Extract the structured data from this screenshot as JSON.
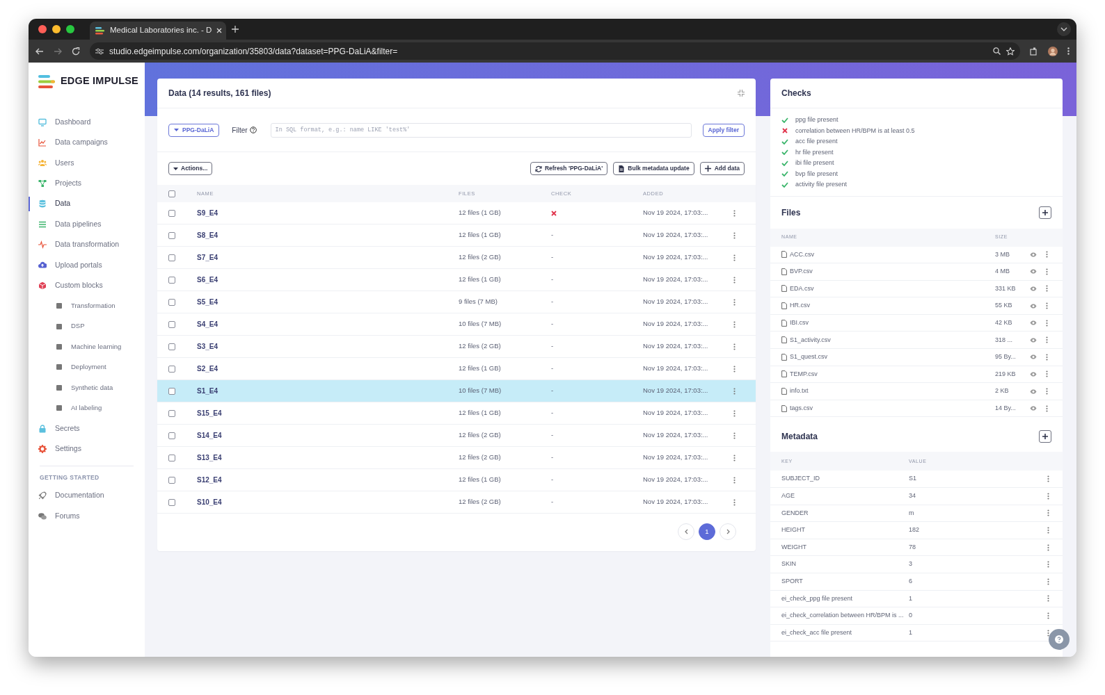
{
  "browser": {
    "tab_title": "Medical Laboratories inc. - D",
    "url": "studio.edgeimpulse.com/organization/35803/data?dataset=PPG-DaLiA&filter="
  },
  "sidebar": {
    "logo": "EDGE IMPULSE",
    "items": [
      {
        "label": "Dashboard",
        "selected": false
      },
      {
        "label": "Data campaigns",
        "selected": false
      },
      {
        "label": "Users",
        "selected": false
      },
      {
        "label": "Projects",
        "selected": false
      },
      {
        "label": "Data",
        "selected": true
      },
      {
        "label": "Data pipelines",
        "selected": false
      },
      {
        "label": "Data transformation",
        "selected": false
      },
      {
        "label": "Upload portals",
        "selected": false
      },
      {
        "label": "Custom blocks",
        "selected": false,
        "children": [
          {
            "label": "Transformation",
            "selected": false
          },
          {
            "label": "DSP",
            "selected": false
          },
          {
            "label": "Machine learning",
            "selected": false
          },
          {
            "label": "Deployment",
            "selected": false
          },
          {
            "label": "Synthetic data",
            "selected": false
          },
          {
            "label": "AI labeling",
            "selected": false
          }
        ]
      },
      {
        "label": "Secrets",
        "selected": false
      },
      {
        "label": "Settings",
        "selected": false
      }
    ],
    "section_heading": "GETTING STARTED",
    "section_items": [
      {
        "label": "Documentation"
      },
      {
        "label": "Forums"
      }
    ]
  },
  "data_card": {
    "title": "Data (14 results, 161 files)",
    "dataset": "PPG-DaLiA",
    "filter_label": "Filter",
    "filter_placeholder": "In SQL format, e.g.: name LIKE 'test%'",
    "apply_button": "Apply filter",
    "actions_button": "Actions...",
    "select_all_checked": false,
    "toolbar": [
      "Refresh 'PPG-DaLiA'",
      "Bulk metadata update",
      "Add data"
    ],
    "columns": [
      "NAME",
      "FILES",
      "CHECK",
      "ADDED"
    ],
    "rows": [
      {
        "name": "S9_E4",
        "files": "12 files (1 GB)",
        "check": {
          "kind": "fail"
        },
        "added": "Nov 19 2024, 17:03:...",
        "checked": false,
        "selected": false
      },
      {
        "name": "S8_E4",
        "files": "12 files (1 GB)",
        "check": {
          "kind": "text",
          "text": "-"
        },
        "added": "Nov 19 2024, 17:03:...",
        "checked": false,
        "selected": false
      },
      {
        "name": "S7_E4",
        "files": "12 files (2 GB)",
        "check": {
          "kind": "text",
          "text": "-"
        },
        "added": "Nov 19 2024, 17:03:...",
        "checked": false,
        "selected": false
      },
      {
        "name": "S6_E4",
        "files": "12 files (1 GB)",
        "check": {
          "kind": "text",
          "text": "-"
        },
        "added": "Nov 19 2024, 17:03:...",
        "checked": false,
        "selected": false
      },
      {
        "name": "S5_E4",
        "files": "9 files (7 MB)",
        "check": {
          "kind": "text",
          "text": "-"
        },
        "added": "Nov 19 2024, 17:03:...",
        "checked": false,
        "selected": false
      },
      {
        "name": "S4_E4",
        "files": "10 files (7 MB)",
        "check": {
          "kind": "text",
          "text": "-"
        },
        "added": "Nov 19 2024, 17:03:...",
        "checked": false,
        "selected": false
      },
      {
        "name": "S3_E4",
        "files": "12 files (2 GB)",
        "check": {
          "kind": "text",
          "text": "-"
        },
        "added": "Nov 19 2024, 17:03:...",
        "checked": false,
        "selected": false
      },
      {
        "name": "S2_E4",
        "files": "12 files (1 GB)",
        "check": {
          "kind": "text",
          "text": "-"
        },
        "added": "Nov 19 2024, 17:03:...",
        "checked": false,
        "selected": false
      },
      {
        "name": "S1_E4",
        "files": "10 files (7 MB)",
        "check": {
          "kind": "text",
          "text": "-"
        },
        "added": "Nov 19 2024, 17:03:...",
        "checked": false,
        "selected": true
      },
      {
        "name": "S15_E4",
        "files": "12 files (1 GB)",
        "check": {
          "kind": "text",
          "text": "-"
        },
        "added": "Nov 19 2024, 17:03:...",
        "checked": false,
        "selected": false
      },
      {
        "name": "S14_E4",
        "files": "12 files (2 GB)",
        "check": {
          "kind": "text",
          "text": "-"
        },
        "added": "Nov 19 2024, 17:03:...",
        "checked": false,
        "selected": false
      },
      {
        "name": "S13_E4",
        "files": "12 files (2 GB)",
        "check": {
          "kind": "text",
          "text": "-"
        },
        "added": "Nov 19 2024, 17:03:...",
        "checked": false,
        "selected": false
      },
      {
        "name": "S12_E4",
        "files": "12 files (1 GB)",
        "check": {
          "kind": "text",
          "text": "-"
        },
        "added": "Nov 19 2024, 17:03:...",
        "checked": false,
        "selected": false
      },
      {
        "name": "S10_E4",
        "files": "12 files (2 GB)",
        "check": {
          "kind": "text",
          "text": "-"
        },
        "added": "Nov 19 2024, 17:03:...",
        "checked": false,
        "selected": false
      }
    ],
    "pages": [
      {
        "label": "1",
        "selected": true
      }
    ]
  },
  "checks": {
    "title": "Checks",
    "items": [
      {
        "text": "ppg file present",
        "passed": true
      },
      {
        "text": "correlation between HR/BPM is at least 0.5",
        "passed": false
      },
      {
        "text": "acc file present",
        "passed": true
      },
      {
        "text": "hr file present",
        "passed": true
      },
      {
        "text": "ibi file present",
        "passed": true
      },
      {
        "text": "bvp file present",
        "passed": true
      },
      {
        "text": "activity file present",
        "passed": true
      }
    ]
  },
  "files": {
    "title": "Files",
    "columns": [
      "NAME",
      "SIZE"
    ],
    "rows": [
      {
        "name": "ACC.csv",
        "size": "3 MB"
      },
      {
        "name": "BVP.csv",
        "size": "4 MB"
      },
      {
        "name": "EDA.csv",
        "size": "331 KB"
      },
      {
        "name": "HR.csv",
        "size": "55 KB"
      },
      {
        "name": "IBI.csv",
        "size": "42 KB"
      },
      {
        "name": "S1_activity.csv",
        "size": "318 ..."
      },
      {
        "name": "S1_quest.csv",
        "size": "95 By..."
      },
      {
        "name": "TEMP.csv",
        "size": "219 KB"
      },
      {
        "name": "info.txt",
        "size": "2 KB"
      },
      {
        "name": "tags.csv",
        "size": "14 By..."
      }
    ]
  },
  "metadata": {
    "title": "Metadata",
    "columns": [
      "KEY",
      "VALUE"
    ],
    "rows": [
      {
        "key": "SUBJECT_ID",
        "value": "S1"
      },
      {
        "key": "AGE",
        "value": "34"
      },
      {
        "key": "GENDER",
        "value": "m"
      },
      {
        "key": "HEIGHT",
        "value": "182"
      },
      {
        "key": "WEIGHT",
        "value": "78"
      },
      {
        "key": "SKIN",
        "value": "3"
      },
      {
        "key": "SPORT",
        "value": "6"
      },
      {
        "key": "ei_check_ppg file present",
        "value": "1"
      },
      {
        "key": "ei_check_correlation between HR/BPM is ...",
        "value": "0"
      },
      {
        "key": "ei_check_acc file present",
        "value": "1"
      }
    ]
  }
}
